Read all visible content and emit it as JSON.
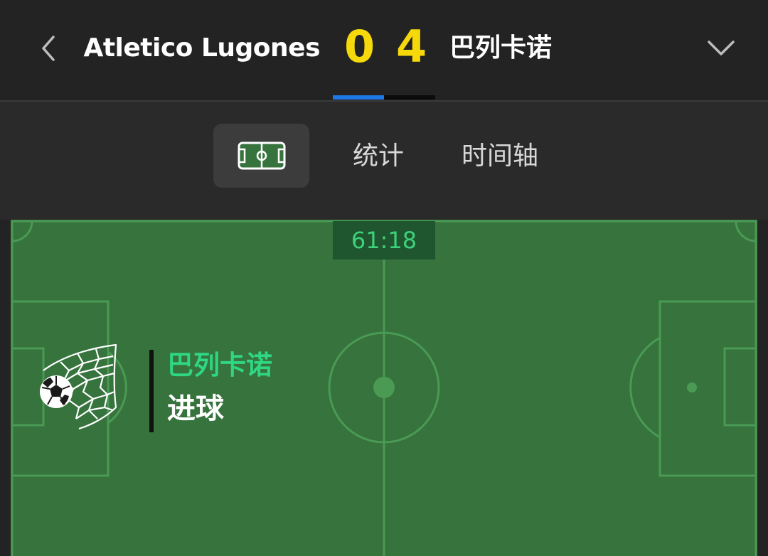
{
  "header": {
    "back_icon": "chevron-left-icon",
    "home_team": "Atletico Lugones",
    "home_score": "0",
    "away_score": "4",
    "away_team": "巴列卡诺",
    "expand_icon": "chevron-down-icon",
    "score_color": "#f5d90a",
    "page_indicator": {
      "pages": 2,
      "active": 0,
      "active_color": "#1e78e6"
    }
  },
  "tabs": [
    {
      "id": "field",
      "icon": "football-field-icon",
      "active": true
    },
    {
      "id": "stats",
      "label": "统计",
      "active": false
    },
    {
      "id": "timeline",
      "label": "时间轴",
      "active": false
    }
  ],
  "match": {
    "clock": "61:18",
    "event": {
      "icon": "goal-net-icon",
      "team": "巴列卡诺",
      "type": "进球",
      "team_color": "#2fd683"
    }
  },
  "colors": {
    "background": "#232323",
    "tab_bar": "#2a2a2a",
    "pitch": "#36733d",
    "pitch_lines": "#4a9a54",
    "clock_bg": "#1f5630",
    "clock_text": "#3ed17a"
  }
}
